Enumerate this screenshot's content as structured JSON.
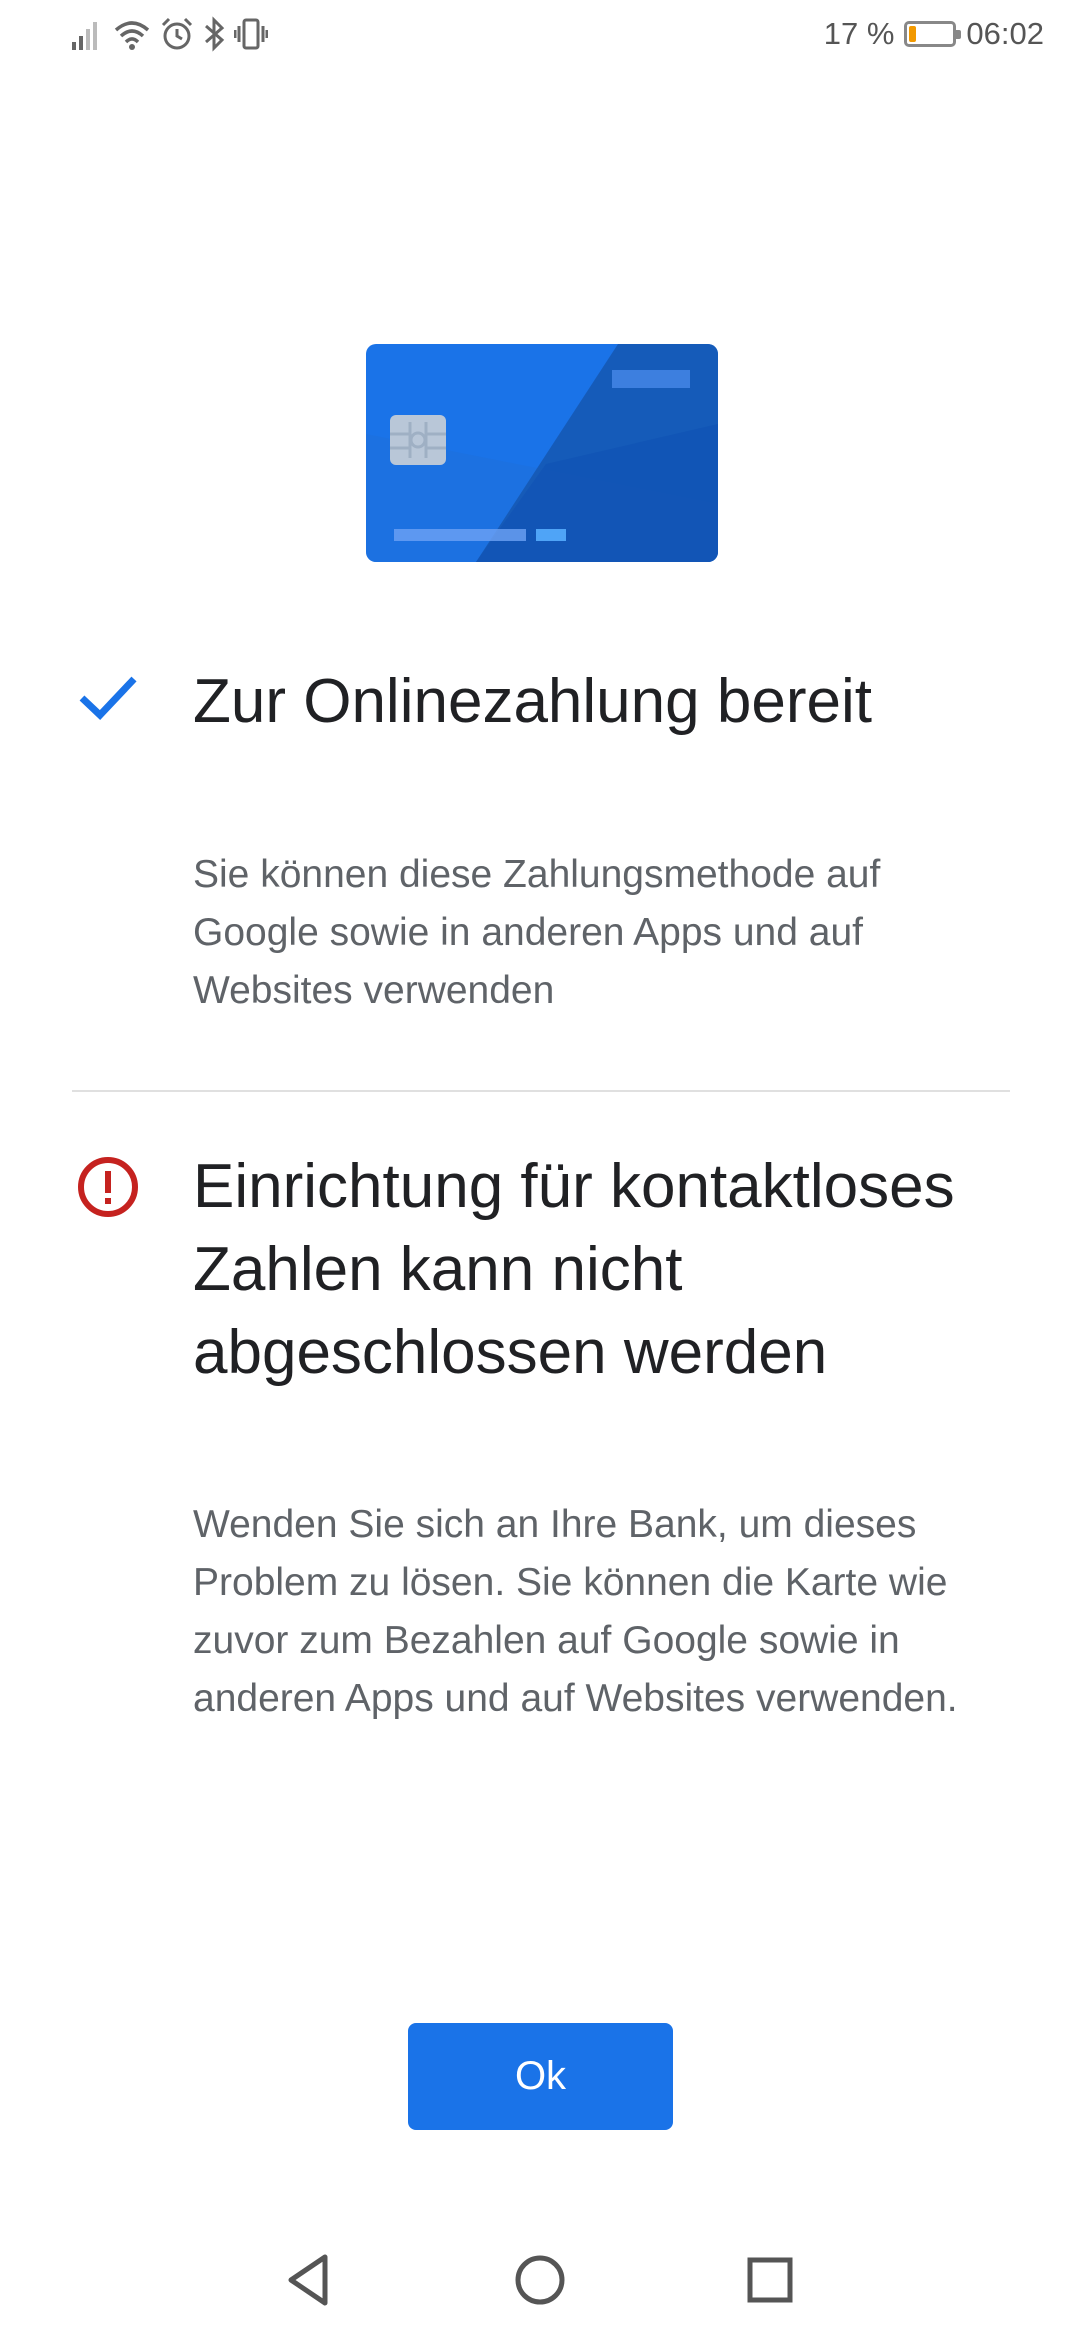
{
  "status_bar": {
    "icons": [
      "signal-icon",
      "wifi-icon",
      "alarm-icon",
      "bluetooth-icon",
      "vibrate-icon",
      "battery-icon"
    ],
    "battery_percent": "17 %",
    "battery_level": 0.17,
    "time": "06:02"
  },
  "illustration": {
    "icon": "credit-card-icon",
    "colors": {
      "main": "#1a73e8",
      "dark": "#1557b0"
    }
  },
  "online_section": {
    "icon": "check-icon",
    "title": "Zur Onlinezahlung bereit",
    "body": "Sie können diese Zahlungsmethode auf Google sowie in anderen Apps und auf Websites verwenden",
    "color": "#1a73e8"
  },
  "contactless_section": {
    "icon": "error-icon",
    "title": "Einrichtung für kontaktloses Zahlen kann nicht abgeschlossen werden",
    "body": "Wenden Sie sich an Ihre Bank, um dieses Problem zu lösen. Sie können die Karte wie zuvor zum Bezahlen auf Google sowie in anderen Apps und auf Websites verwenden.",
    "color": "#c5221f"
  },
  "ok_button": {
    "label": "Ok",
    "color": "#1a73e8"
  },
  "nav_bar": {
    "icons": [
      "back-icon",
      "home-icon",
      "recents-icon"
    ]
  }
}
